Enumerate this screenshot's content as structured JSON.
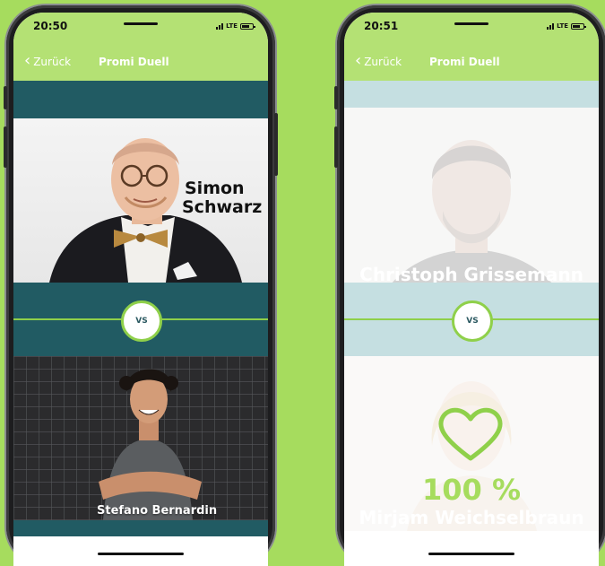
{
  "colors": {
    "background": "#a6dc5e",
    "nav_green": "#b4e174",
    "teal": "#215b63",
    "accent": "#8fd04a"
  },
  "left_phone": {
    "time": "20:50",
    "network": "LTE",
    "back_label": "Zurück",
    "title": "Promi Duell",
    "vs_label": "VS",
    "top_name_line1": "Simon",
    "top_name_line2": "Schwarz",
    "bottom_name": "Stefano Bernardin"
  },
  "right_phone": {
    "time": "20:51",
    "network": "LTE",
    "back_label": "Zurück",
    "title": "Promi Duell",
    "vs_label": "VS",
    "top_name": "Christoph Grissemann",
    "bottom_name": "Mirjam Weichselbraun",
    "result_percent": "100 %",
    "result_icon": "heart-icon"
  }
}
